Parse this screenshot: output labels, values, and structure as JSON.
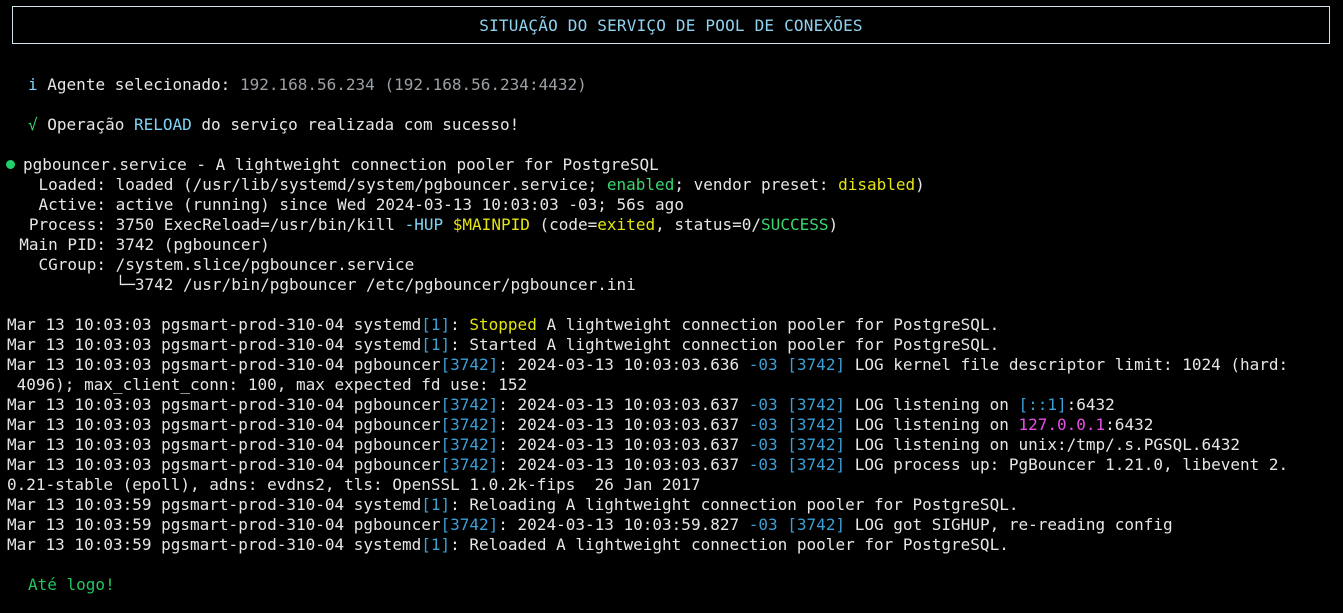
{
  "header": {
    "title": "SITUAÇÃO DO SERVIÇO DE POOL DE CONEXÕES"
  },
  "agent": {
    "icon": "i",
    "label": "Agente selecionado:",
    "value": "192.168.56.234 (192.168.56.234:4432)"
  },
  "operation": {
    "icon": "√",
    "prefix": "Operação",
    "action": "RELOAD",
    "suffix": "do serviço realizada com sucesso!"
  },
  "status": {
    "service_line": "pgbouncer.service - A lightweight connection pooler for PostgreSQL",
    "loaded_label": "Loaded:",
    "loaded_pre": "loaded (/usr/lib/systemd/system/pgbouncer.service;",
    "loaded_enabled": "enabled",
    "loaded_mid": "; vendor preset:",
    "loaded_disabled": "disabled",
    "loaded_post": ")",
    "active_label": "Active:",
    "active_value": "active (running) since Wed 2024-03-13 10:03:03 -03; 56s ago",
    "process_label": "Process:",
    "process_pre": "3750 ExecReload=/usr/bin/kill",
    "process_hup": "-HUP",
    "process_mainpid": "$MAINPID",
    "process_code_pre": "(code=",
    "process_exited": "exited",
    "process_status_pre": ", status=0/",
    "process_success": "SUCCESS",
    "process_post": ")",
    "mainpid_label": "Main PID:",
    "mainpid_value": "3742 (pgbouncer)",
    "cgroup_label": "CGroup:",
    "cgroup_value": "/system.slice/pgbouncer.service",
    "cgroup_child": "└─3742 /usr/bin/pgbouncer /etc/pgbouncer/pgbouncer.ini"
  },
  "logs": {
    "l1_prefix": "Mar 13 10:03:03 pgsmart-prod-310-04 systemd",
    "l1_pid": "[1]",
    "l1_colon": ": ",
    "l1_word": "Stopped",
    "l1_rest": " A lightweight connection pooler for PostgreSQL.",
    "l2_prefix": "Mar 13 10:03:03 pgsmart-prod-310-04 systemd",
    "l2_pid": "[1]",
    "l2_rest": ": Started A lightweight connection pooler for PostgreSQL.",
    "l3_prefix": "Mar 13 10:03:03 pgsmart-prod-310-04 pgbouncer",
    "l3_pid": "[3742]",
    "l3_ts": ": 2024-03-13 10:03:03.636 ",
    "l3_tz": "-03",
    "l3_sp": " ",
    "l3_tag": "[3742]",
    "l3_rest": " LOG kernel file descriptor limit: 1024 (hard:",
    "l3_cont": " 4096); max_client_conn: 100, max expected fd use: 152",
    "l4_prefix": "Mar 13 10:03:03 pgsmart-prod-310-04 pgbouncer",
    "l4_pid": "[3742]",
    "l4_ts": ": 2024-03-13 10:03:03.637 ",
    "l4_tz": "-03",
    "l4_tag": "[3742]",
    "l4_mid": " LOG listening on ",
    "l4_addr": "[::1]",
    "l4_port": ":6432",
    "l5_prefix": "Mar 13 10:03:03 pgsmart-prod-310-04 pgbouncer",
    "l5_pid": "[3742]",
    "l5_ts": ": 2024-03-13 10:03:03.637 ",
    "l5_tz": "-03",
    "l5_tag": "[3742]",
    "l5_mid": " LOG listening on ",
    "l5_addr": "127.0.0.1",
    "l5_port": ":6432",
    "l6_prefix": "Mar 13 10:03:03 pgsmart-prod-310-04 pgbouncer",
    "l6_pid": "[3742]",
    "l6_ts": ": 2024-03-13 10:03:03.637 ",
    "l6_tz": "-03",
    "l6_tag": "[3742]",
    "l6_rest": " LOG listening on unix:/tmp/.s.PGSQL.6432",
    "l7_prefix": "Mar 13 10:03:03 pgsmart-prod-310-04 pgbouncer",
    "l7_pid": "[3742]",
    "l7_ts": ": 2024-03-13 10:03:03.637 ",
    "l7_tz": "-03",
    "l7_tag": "[3742]",
    "l7_rest": " LOG process up: PgBouncer 1.21.0, libevent 2.",
    "l7_cont": "0.21-stable (epoll), adns: evdns2, tls: OpenSSL 1.0.2k-fips  26 Jan 2017",
    "l8_prefix": "Mar 13 10:03:59 pgsmart-prod-310-04 systemd",
    "l8_pid": "[1]",
    "l8_rest": ": Reloading A lightweight connection pooler for PostgreSQL.",
    "l9_prefix": "Mar 13 10:03:59 pgsmart-prod-310-04 pgbouncer",
    "l9_pid": "[3742]",
    "l9_ts": ": 2024-03-13 10:03:59.827 ",
    "l9_tz": "-03",
    "l9_tag": "[3742]",
    "l9_rest": " LOG got SIGHUP, re-reading config",
    "l10_prefix": "Mar 13 10:03:59 pgsmart-prod-310-04 systemd",
    "l10_pid": "[1]",
    "l10_rest": ": Reloaded A lightweight connection pooler for PostgreSQL."
  },
  "footer": {
    "bye": "Até logo!"
  },
  "colors": {
    "background": "#000000",
    "text": "#e6e6e6",
    "title": "#8fd2f0",
    "success": "#22c55e",
    "warning": "#e5e510",
    "pid": "#3aa0d8",
    "ip": "#e64fe6",
    "status_dot": "#22d06b"
  }
}
